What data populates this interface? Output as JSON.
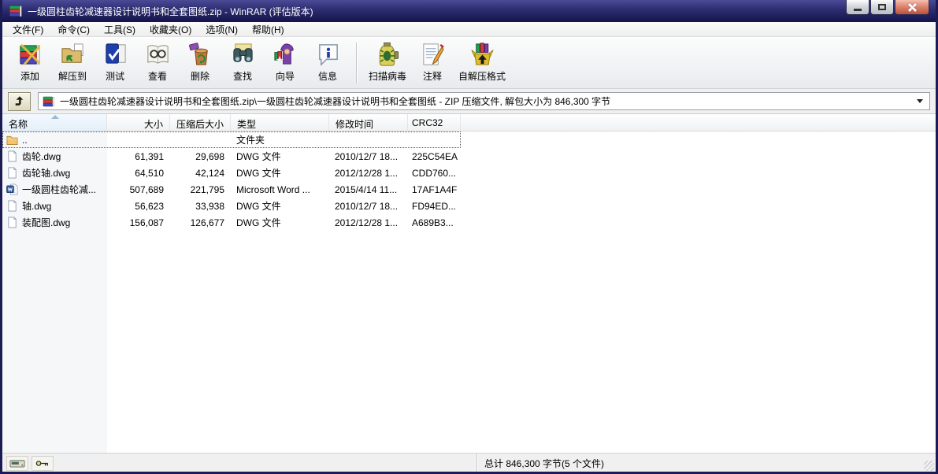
{
  "window": {
    "title": "一级圆柱齿轮减速器设计说明书和全套图纸.zip - WinRAR (评估版本)",
    "controls": [
      "minimize",
      "maximize",
      "close"
    ]
  },
  "colors": {
    "titlebar": "#20205c",
    "close_button": "#c05138",
    "sorted_header_bg": "#e3eff9",
    "list_bg": "#ffffff",
    "chrome_bg": "#f0f0f0"
  },
  "menu": {
    "items": [
      {
        "label": "文件(F)"
      },
      {
        "label": "命令(C)"
      },
      {
        "label": "工具(S)"
      },
      {
        "label": "收藏夹(O)"
      },
      {
        "label": "选项(N)"
      },
      {
        "label": "帮助(H)"
      }
    ]
  },
  "toolbar": {
    "buttons": [
      {
        "label": "添加",
        "icon": "archive-add-icon"
      },
      {
        "label": "解压到",
        "icon": "extract-to-icon"
      },
      {
        "label": "测试",
        "icon": "test-archive-icon"
      },
      {
        "label": "查看",
        "icon": "view-file-icon"
      },
      {
        "label": "删除",
        "icon": "delete-icon"
      },
      {
        "label": "查找",
        "icon": "find-icon"
      },
      {
        "label": "向导",
        "icon": "wizard-icon"
      },
      {
        "label": "信息",
        "icon": "info-icon"
      },
      {
        "label": "扫描病毒",
        "icon": "virus-scan-icon"
      },
      {
        "label": "注释",
        "icon": "comment-icon"
      },
      {
        "label": "自解压格式",
        "icon": "sfx-icon"
      }
    ]
  },
  "addressbar": {
    "up_icon": "folder-up-icon",
    "archive_icon": "winrar-archive-icon",
    "path": "一级圆柱齿轮减速器设计说明书和全套图纸.zip\\一级圆柱齿轮减速器设计说明书和全套图纸 - ZIP 压缩文件, 解包大小为 846,300 字节"
  },
  "list": {
    "sort": {
      "column": "名称",
      "direction": "asc"
    },
    "columns": [
      "名称",
      "大小",
      "压缩后大小",
      "类型",
      "修改时间",
      "CRC32"
    ],
    "rows": [
      {
        "name": "..",
        "icon": "folder-icon",
        "size": "",
        "packed": "",
        "type": "文件夹",
        "modified": "",
        "crc": ""
      },
      {
        "name": "齿轮.dwg",
        "icon": "file-icon",
        "size": "61,391",
        "packed": "29,698",
        "type": "DWG 文件",
        "modified": "2010/12/7 18...",
        "crc": "225C54EA"
      },
      {
        "name": "齿轮轴.dwg",
        "icon": "file-icon",
        "size": "64,510",
        "packed": "42,124",
        "type": "DWG 文件",
        "modified": "2012/12/28 1...",
        "crc": "CDD760..."
      },
      {
        "name": "一级圆柱齿轮减...",
        "icon": "word-icon",
        "size": "507,689",
        "packed": "221,795",
        "type": "Microsoft Word ...",
        "modified": "2015/4/14 11...",
        "crc": "17AF1A4F"
      },
      {
        "name": "轴.dwg",
        "icon": "file-icon",
        "size": "56,623",
        "packed": "33,938",
        "type": "DWG 文件",
        "modified": "2010/12/7 18...",
        "crc": "FD94ED..."
      },
      {
        "name": "装配图.dwg",
        "icon": "file-icon",
        "size": "156,087",
        "packed": "126,677",
        "type": "DWG 文件",
        "modified": "2012/12/28 1...",
        "crc": "A689B3..."
      }
    ]
  },
  "statusbar": {
    "icons": [
      "drive-icon",
      "key-icon"
    ],
    "total": "总计 846,300 字节(5 个文件)"
  }
}
